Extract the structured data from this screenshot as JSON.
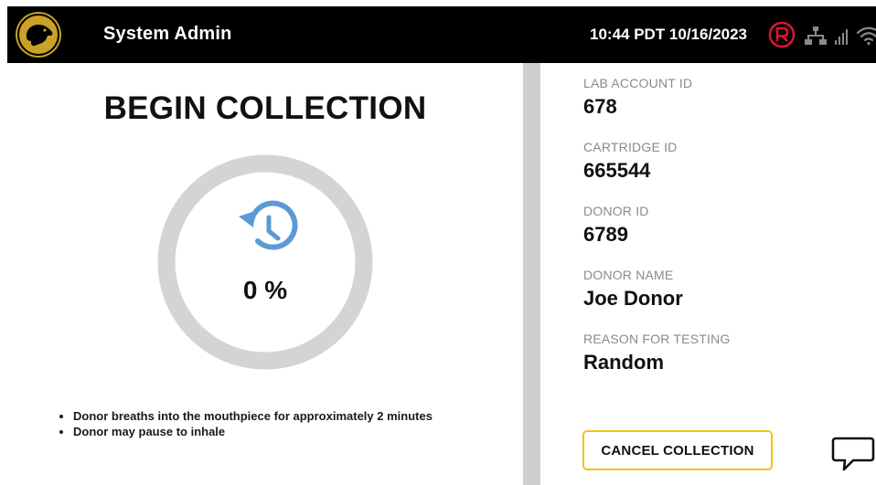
{
  "header": {
    "title": "System Admin",
    "datetime": "10:44 PDT 10/16/2023",
    "status_icons": [
      "registered-r-icon",
      "network-icon",
      "signal-bars-icon",
      "wifi-icon"
    ],
    "logo_icon": "dog-logo-icon"
  },
  "collection": {
    "title": "BEGIN COLLECTION",
    "progress_label": "0 %",
    "progress_percent": 0,
    "progress_icon": "history-clock-icon",
    "instructions": [
      "Donor breaths into the mouthpiece for approximately 2 minutes",
      "Donor may pause to inhale"
    ]
  },
  "details": {
    "fields": [
      {
        "label": "LAB ACCOUNT ID",
        "value": "678"
      },
      {
        "label": "CARTRIDGE ID",
        "value": "665544"
      },
      {
        "label": "DONOR ID",
        "value": "6789"
      },
      {
        "label": "DONOR NAME",
        "value": "Joe Donor"
      },
      {
        "label": "REASON FOR TESTING",
        "value": "Random"
      }
    ],
    "cancel_label": "CANCEL COLLECTION",
    "chat_icon": "chat-bubble-icon"
  },
  "colors": {
    "header_bg": "#000000",
    "logo_gold": "#c9a227",
    "accent_red": "#e0142e",
    "button_border": "#f2c318",
    "progress_icon": "#5b9bd5",
    "ring": "#d4d4d6",
    "divider": "#cfcfcf",
    "label_gray": "#8a8a8a"
  }
}
